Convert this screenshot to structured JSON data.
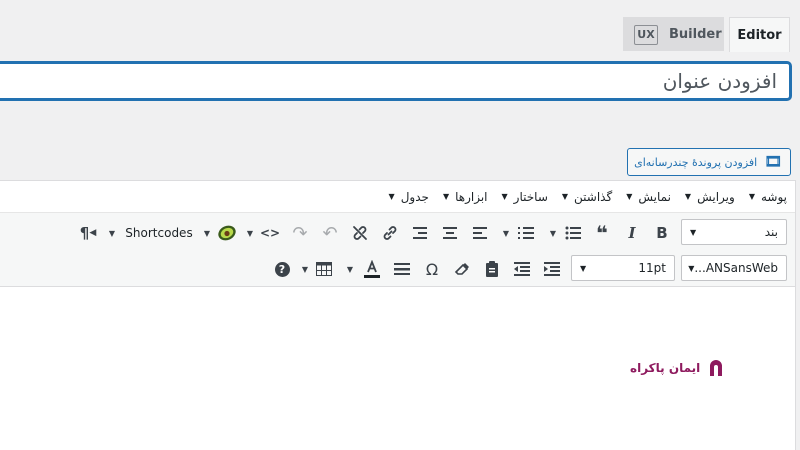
{
  "tabs": {
    "editor_label": "Editor",
    "ux_badge": "UX",
    "ux_label": "Builder"
  },
  "title_input": {
    "placeholder": "افزودن عنوان"
  },
  "add_media": {
    "label": "افزودن پروندهٔ چندرسانه‌ای"
  },
  "menubar": {
    "items": [
      "پوشه",
      "ویرایش",
      "نمایش",
      "گذاشتن",
      "ساختار",
      "ابزارها",
      "جدول"
    ]
  },
  "toolbar": {
    "paragraph_select": "بند",
    "shortcodes_label": "Shortcodes",
    "font_family_select": "ANSansWeb...",
    "font_size_select": "11pt",
    "bold_glyph": "B",
    "italic_glyph": "I",
    "quote_glyph": "❝",
    "omega_glyph": "Ω",
    "help_glyph": "?",
    "pilcrow_glyph": "¶",
    "code_glyph": "<>"
  },
  "logo": {
    "text": "ایمان پاکراه"
  },
  "colors": {
    "accent": "#2271b1",
    "brand": "#8e1a5e"
  }
}
